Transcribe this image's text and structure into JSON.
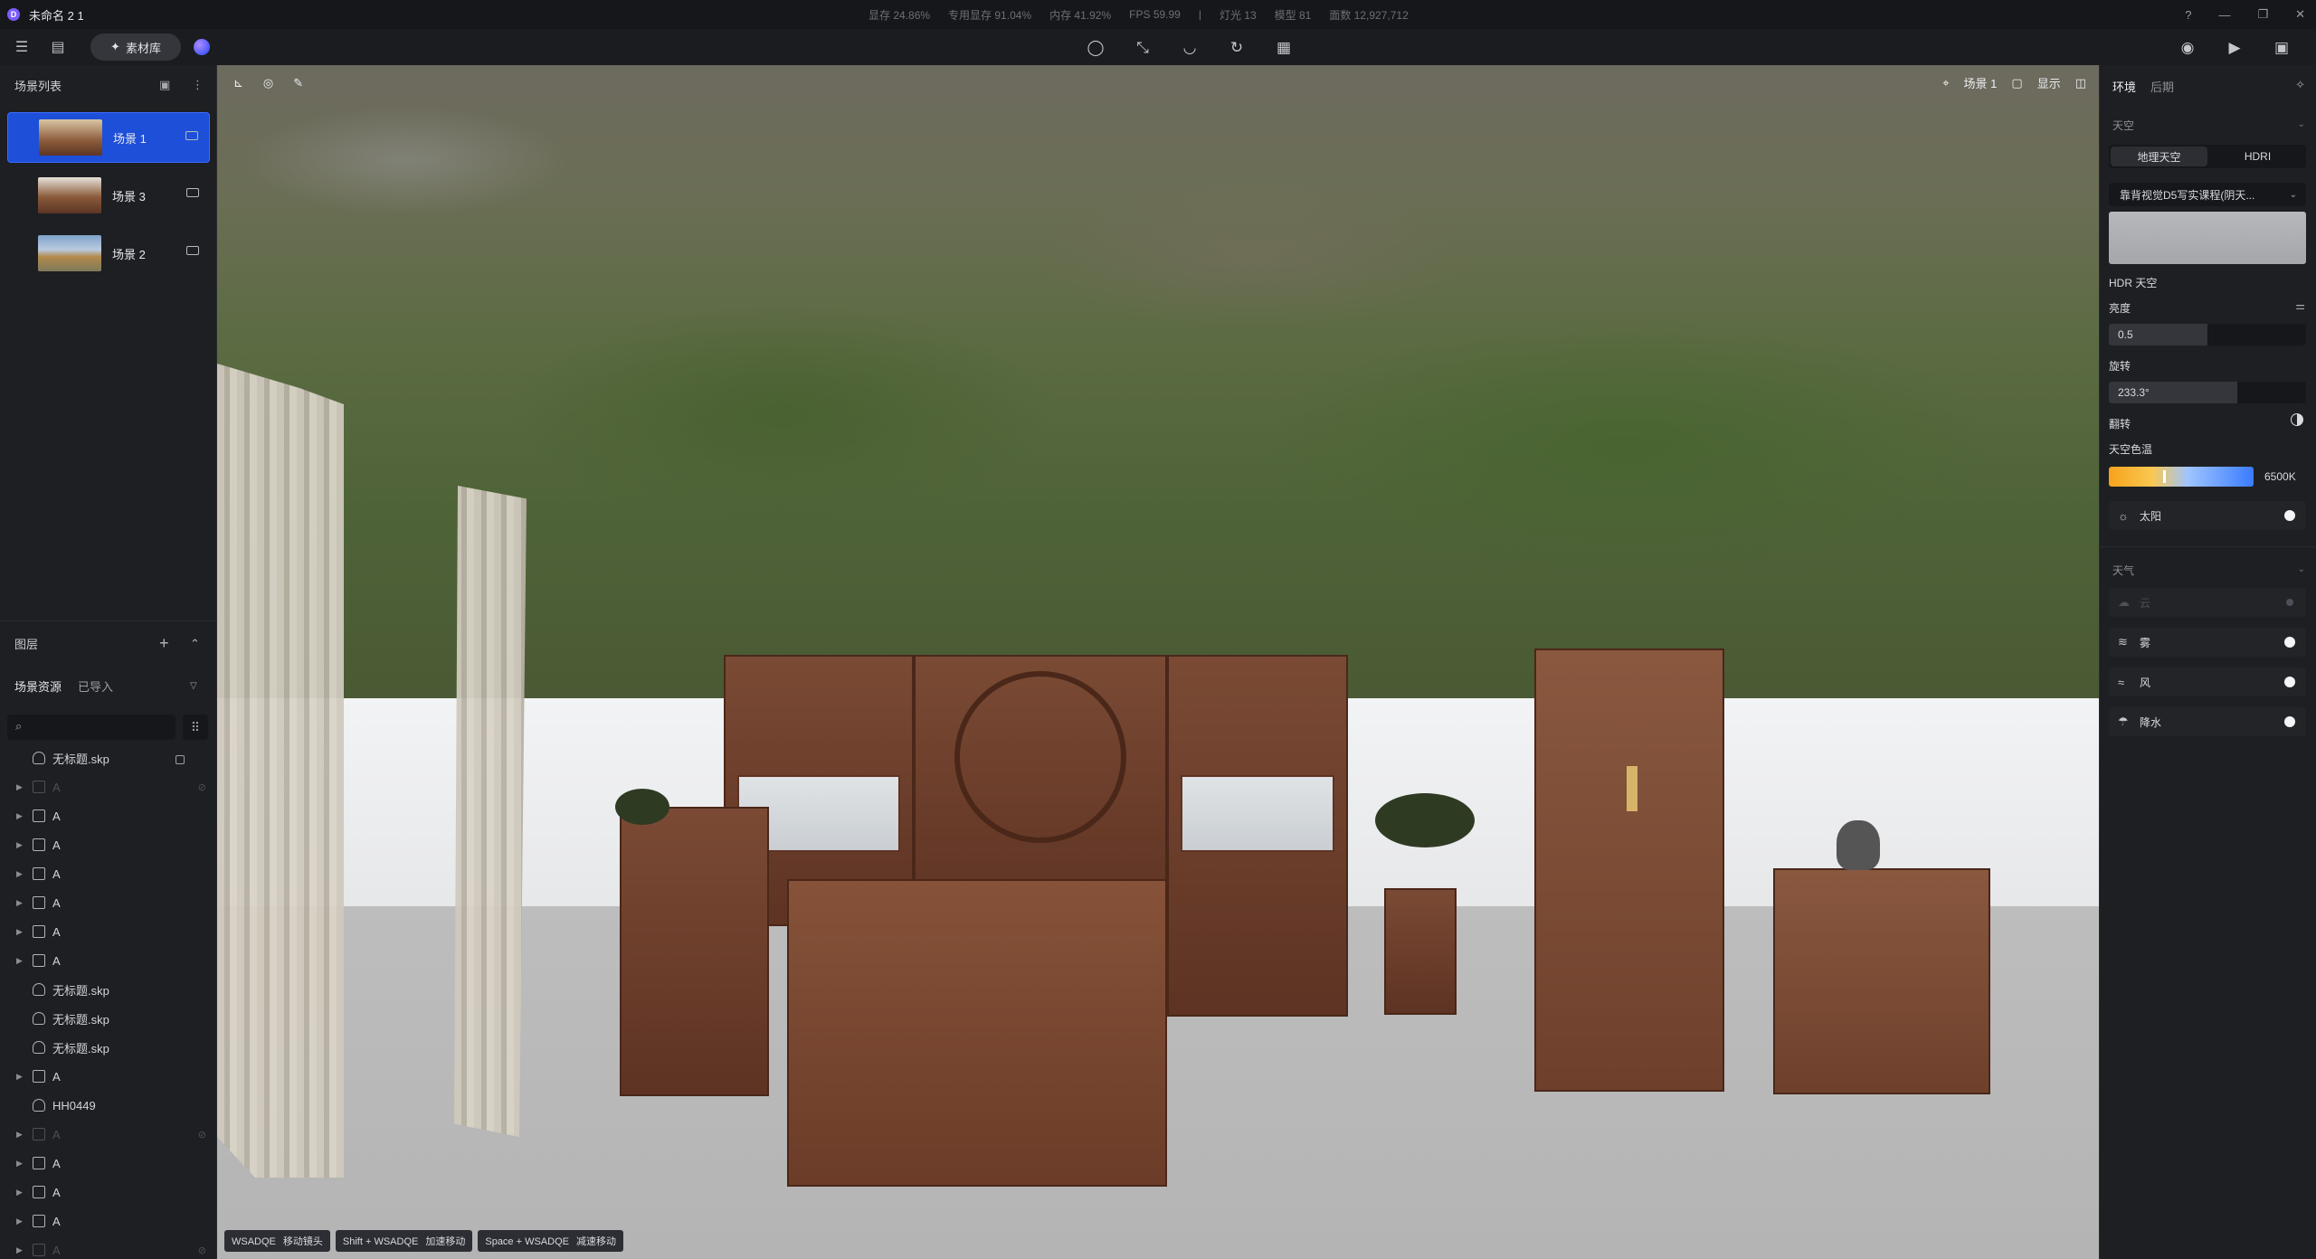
{
  "window": {
    "title": "未命名 2 1",
    "stats": [
      "显存 24.86%",
      "专用显存 91.04%",
      "内存 41.92%",
      "FPS 59.99",
      "|",
      "灯光 13",
      "模型 81",
      "面数 12,927,712"
    ]
  },
  "toolbar": {
    "material_label": "素材库"
  },
  "left_panel": {
    "scene_list_title": "场景列表",
    "scenes": [
      {
        "label": "场景 1",
        "active": true
      },
      {
        "label": "场景 3",
        "active": false
      },
      {
        "label": "场景 2",
        "active": false
      }
    ],
    "layers_title": "图层",
    "resource_tabs": [
      "场景资源",
      "已导入"
    ],
    "tree": [
      {
        "label": "无标题.skp",
        "type": "model",
        "expandable": false,
        "dim": false,
        "locked": true
      },
      {
        "label": "A",
        "type": "group",
        "expandable": true,
        "dim": true
      },
      {
        "label": "A",
        "type": "group",
        "expandable": true,
        "dim": false
      },
      {
        "label": "A",
        "type": "group",
        "expandable": true,
        "dim": false
      },
      {
        "label": "A",
        "type": "group",
        "expandable": true,
        "dim": false
      },
      {
        "label": "A",
        "type": "group",
        "expandable": true,
        "dim": false
      },
      {
        "label": "A",
        "type": "group",
        "expandable": true,
        "dim": false
      },
      {
        "label": "A",
        "type": "group",
        "expandable": true,
        "dim": false
      },
      {
        "label": "无标题.skp",
        "type": "model",
        "expandable": false,
        "dim": false
      },
      {
        "label": "无标题.skp",
        "type": "model",
        "expandable": false,
        "dim": false
      },
      {
        "label": "无标题.skp",
        "type": "model",
        "expandable": false,
        "dim": false
      },
      {
        "label": "A",
        "type": "group",
        "expandable": true,
        "dim": false
      },
      {
        "label": "HH0449",
        "type": "model",
        "expandable": false,
        "dim": false
      },
      {
        "label": "A",
        "type": "group",
        "expandable": true,
        "dim": true
      },
      {
        "label": "A",
        "type": "group",
        "expandable": true,
        "dim": false
      },
      {
        "label": "A",
        "type": "group",
        "expandable": true,
        "dim": false
      },
      {
        "label": "A",
        "type": "group",
        "expandable": true,
        "dim": false
      },
      {
        "label": "A",
        "type": "group",
        "expandable": true,
        "dim": true
      }
    ]
  },
  "viewport": {
    "scene_label": "场景 1",
    "display_label": "显示",
    "hints": [
      {
        "key": "WSADQE",
        "action": "移动镜头"
      },
      {
        "key": "Shift + WSADQE",
        "action": "加速移动"
      },
      {
        "key": "Space + WSADQE",
        "action": "减速移动"
      }
    ]
  },
  "right_panel": {
    "tabs": [
      "环境",
      "后期"
    ],
    "sky_section": "天空",
    "sky_modes": [
      "地理天空",
      "HDRI"
    ],
    "active_sky_mode": "地理天空",
    "hdr_selected": "靠背视觉D5写实课程(阴天...",
    "hdr_sky_label": "HDR 天空",
    "brightness_label": "亮度",
    "brightness_value": "0.5",
    "brightness_fill": 0.5,
    "rotation_label": "旋转",
    "rotation_value": "233.3°",
    "rotation_fill": 0.65,
    "flip_label": "翻转",
    "sky_temp_label": "天空色温",
    "sky_temp_value": "6500K",
    "sun_label": "太阳",
    "weather_section": "天气",
    "weather": [
      {
        "label": "云",
        "icon": "cloud-icon",
        "enabled": false
      },
      {
        "label": "雾",
        "icon": "fog-icon",
        "enabled": true
      },
      {
        "label": "风",
        "icon": "wind-icon",
        "enabled": true
      },
      {
        "label": "降水",
        "icon": "rain-icon",
        "enabled": true
      }
    ]
  }
}
